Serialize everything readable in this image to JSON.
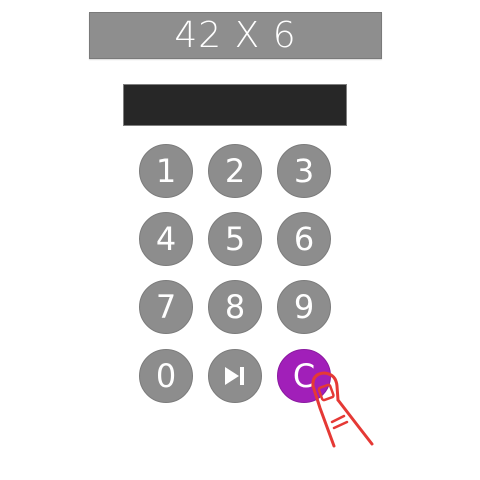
{
  "problem": {
    "text": "42 X 6"
  },
  "answer": {
    "value": ""
  },
  "keypad": {
    "keys": [
      {
        "label": "1"
      },
      {
        "label": "2"
      },
      {
        "label": "3"
      },
      {
        "label": "4"
      },
      {
        "label": "5"
      },
      {
        "label": "6"
      },
      {
        "label": "7"
      },
      {
        "label": "8"
      },
      {
        "label": "9"
      },
      {
        "label": "0"
      },
      {
        "label": "",
        "icon": "skip-next-icon"
      },
      {
        "label": "C"
      }
    ]
  },
  "colors": {
    "key_bg": "#8d8d8d",
    "clear_bg": "#a11fb9",
    "problem_bg": "#8e8e8e",
    "answer_bg": "#272727",
    "finger_stroke": "#e53935"
  },
  "overlay": {
    "icon": "tap-finger-icon"
  }
}
